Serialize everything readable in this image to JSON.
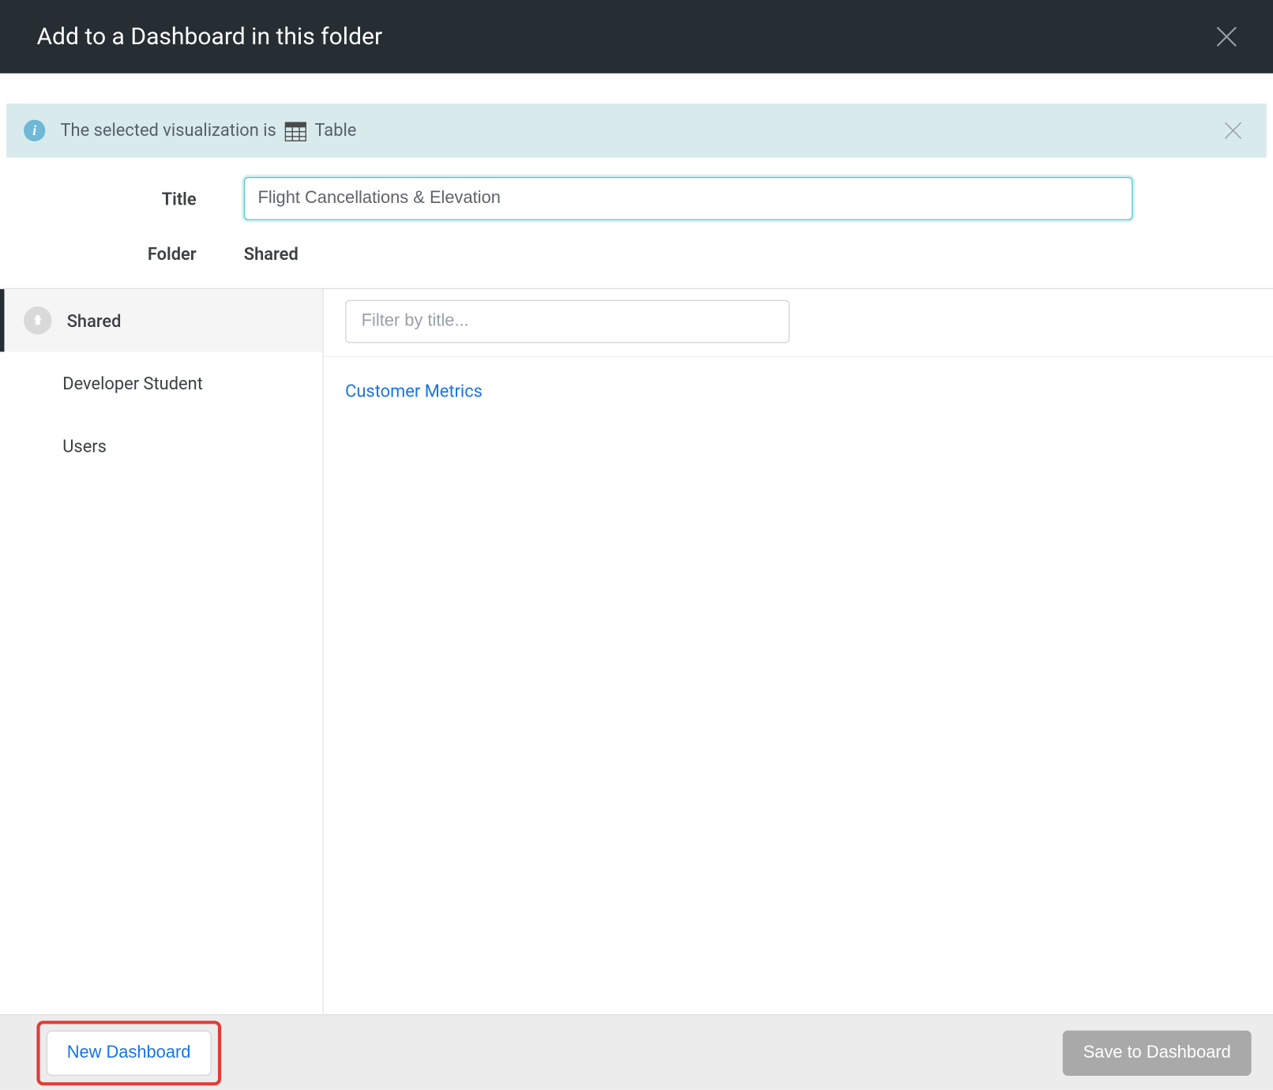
{
  "header": {
    "title": "Add to a Dashboard in this folder"
  },
  "info": {
    "prefix": "The selected visualization is",
    "viz_name": "Table",
    "icon_name": "table-icon"
  },
  "form": {
    "title_label": "Title",
    "title_value": "Flight Cancellations & Elevation",
    "folder_label": "Folder",
    "folder_value": "Shared"
  },
  "sidebar": {
    "items": [
      {
        "label": "Shared",
        "active": true,
        "pinned": true
      },
      {
        "label": "Developer Student",
        "active": false,
        "pinned": false
      },
      {
        "label": "Users",
        "active": false,
        "pinned": false
      }
    ]
  },
  "main": {
    "filter_placeholder": "Filter by title...",
    "dashboards": [
      {
        "label": "Customer Metrics"
      }
    ]
  },
  "footer": {
    "new_dashboard_label": "New Dashboard",
    "save_label": "Save to Dashboard"
  }
}
